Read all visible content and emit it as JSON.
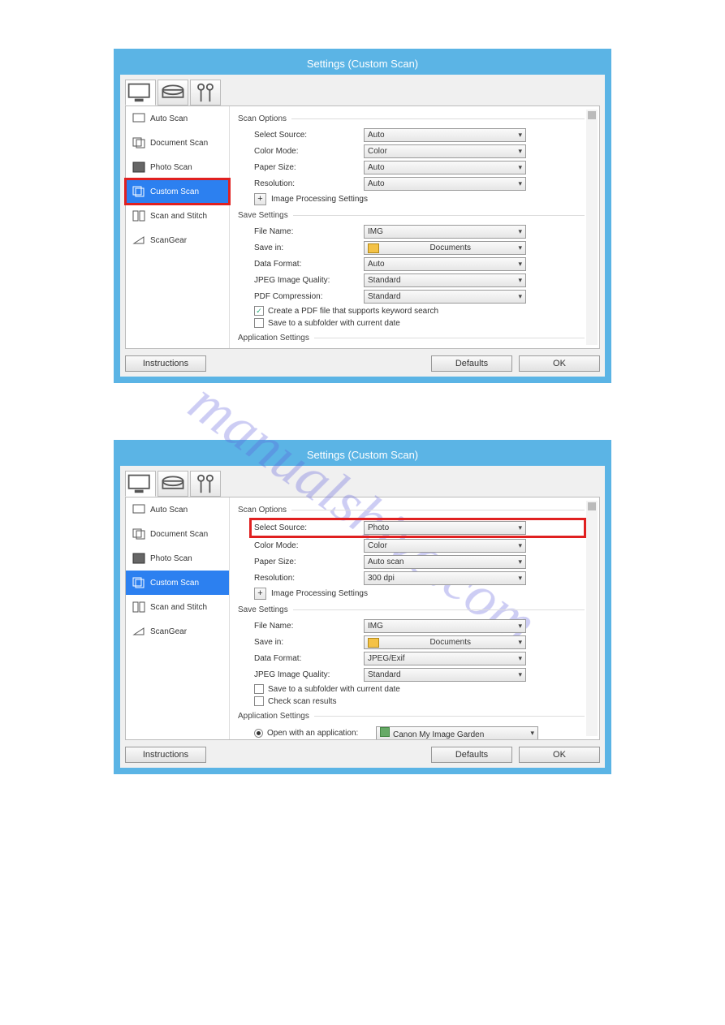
{
  "watermark": "manualshive.com",
  "window1": {
    "title": "Settings (Custom Scan)",
    "sidebar": [
      "Auto Scan",
      "Document Scan",
      "Photo Scan",
      "Custom Scan",
      "Scan and Stitch",
      "ScanGear"
    ],
    "selected_index": 3,
    "highlight_sidebar": true,
    "scan_options": {
      "legend": "Scan Options",
      "select_source_label": "Select Source:",
      "select_source": "Auto",
      "color_mode_label": "Color Mode:",
      "color_mode": "Color",
      "paper_size_label": "Paper Size:",
      "paper_size": "Auto",
      "resolution_label": "Resolution:",
      "resolution": "Auto",
      "image_proc": "Image Processing Settings",
      "highlight_source": false
    },
    "save_settings": {
      "legend": "Save Settings",
      "file_name_label": "File Name:",
      "file_name": "IMG",
      "save_in_label": "Save in:",
      "save_in": "Documents",
      "data_format_label": "Data Format:",
      "data_format": "Auto",
      "jpeg_label": "JPEG Image Quality:",
      "jpeg": "Standard",
      "pdf_label": "PDF Compression:",
      "pdf": "Standard",
      "chk1_label": "Create a PDF file that supports keyword search",
      "chk1": true,
      "chk2_label": "Save to a subfolder with current date",
      "chk2": false
    },
    "app_settings": {
      "legend": "Application Settings"
    },
    "footer": {
      "instructions": "Instructions",
      "defaults": "Defaults",
      "ok": "OK"
    }
  },
  "window2": {
    "title": "Settings (Custom Scan)",
    "sidebar": [
      "Auto Scan",
      "Document Scan",
      "Photo Scan",
      "Custom Scan",
      "Scan and Stitch",
      "ScanGear"
    ],
    "selected_index": 3,
    "highlight_sidebar": false,
    "scan_options": {
      "legend": "Scan Options",
      "select_source_label": "Select Source:",
      "select_source": "Photo",
      "color_mode_label": "Color Mode:",
      "color_mode": "Color",
      "paper_size_label": "Paper Size:",
      "paper_size": "Auto scan",
      "resolution_label": "Resolution:",
      "resolution": "300 dpi",
      "image_proc": "Image Processing Settings",
      "highlight_source": true
    },
    "save_settings": {
      "legend": "Save Settings",
      "file_name_label": "File Name:",
      "file_name": "IMG",
      "save_in_label": "Save in:",
      "save_in": "Documents",
      "data_format_label": "Data Format:",
      "data_format": "JPEG/Exif",
      "jpeg_label": "JPEG Image Quality:",
      "jpeg": "Standard",
      "chk2_label": "Save to a subfolder with current date",
      "chk2": false,
      "chk3_label": "Check scan results",
      "chk3": false
    },
    "app_settings": {
      "legend": "Application Settings",
      "open_with_label": "Open with an application:",
      "open_with": "Canon My Image Garden"
    },
    "footer": {
      "instructions": "Instructions",
      "defaults": "Defaults",
      "ok": "OK"
    }
  }
}
